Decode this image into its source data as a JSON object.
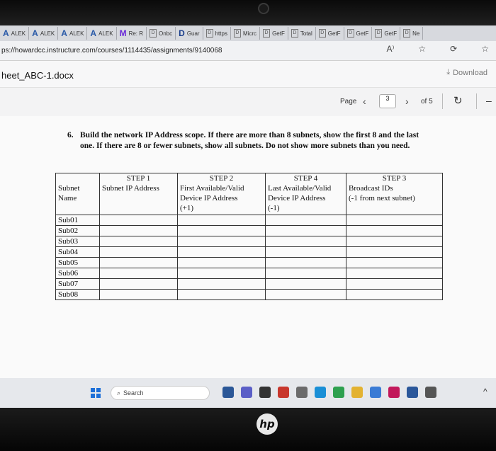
{
  "tabs": [
    {
      "icon": "A",
      "label": "ALEK"
    },
    {
      "icon": "A",
      "label": "ALEK"
    },
    {
      "icon": "A",
      "label": "ALEK"
    },
    {
      "icon": "A",
      "label": "ALEK"
    },
    {
      "icon": "M",
      "label": "Re: R"
    },
    {
      "icon": "D",
      "label": "Onbc"
    },
    {
      "icon": "D",
      "label": "Guar"
    },
    {
      "icon": "D",
      "label": "https"
    },
    {
      "icon": "D",
      "label": "Micrc"
    },
    {
      "icon": "D",
      "label": "GetF"
    },
    {
      "icon": "D",
      "label": "Total"
    },
    {
      "icon": "D",
      "label": "GetF"
    },
    {
      "icon": "D",
      "label": "GetF"
    },
    {
      "icon": "D",
      "label": "GetF"
    },
    {
      "icon": "D",
      "label": "Ne"
    }
  ],
  "address": {
    "url": "ps://howardcc.instructure.com/courses/1114435/assignments/9140068"
  },
  "doc": {
    "title": "heet_ABC-1.docx",
    "download_label": "Download"
  },
  "pager": {
    "page_label": "Page",
    "current": "3",
    "of_label": "of 5"
  },
  "question": {
    "number": "6.",
    "line1": "Build the network IP Address scope.  If there are more than 8 subnets, show the first 8 and the last",
    "line2": "one.  If there are 8 or fewer subnets, show all subnets.  Do not show more subnets than you need."
  },
  "table": {
    "steps": [
      "",
      "STEP 1",
      "STEP 2",
      "STEP 4",
      "STEP 3"
    ],
    "headers": [
      "Subnet\nName",
      "Subnet IP Address",
      "First Available/Valid\nDevice IP Address\n(+1)",
      "Last Available/Valid\nDevice IP Address\n(-1)",
      "Broadcast IDs\n(-1 from next subnet)"
    ],
    "rows": [
      "Sub01",
      "Sub02",
      "Sub03",
      "Sub04",
      "Sub05",
      "Sub06",
      "Sub07",
      "Sub08"
    ]
  },
  "taskbar": {
    "search_label": "Search"
  },
  "brand": {
    "logo": "hp"
  }
}
